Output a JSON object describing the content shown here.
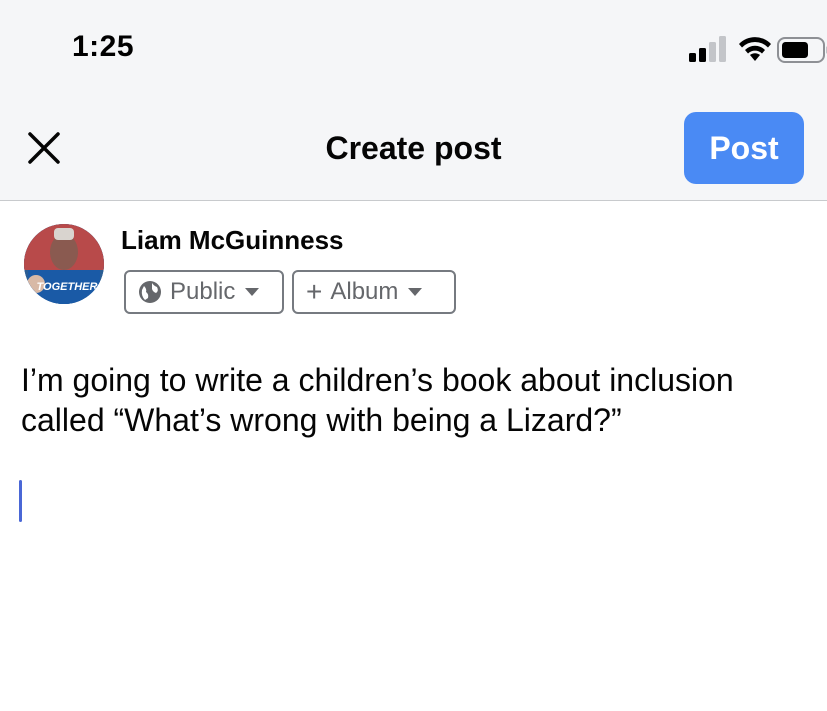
{
  "status_bar": {
    "time": "1:25",
    "icons": [
      "cellular-signal-icon",
      "wifi-icon",
      "battery-icon"
    ]
  },
  "header": {
    "close_icon": "close-icon",
    "title": "Create post",
    "post_label": "Post"
  },
  "author": {
    "name": "Liam McGuinness",
    "avatar_text": "TOGETHER"
  },
  "audience": {
    "label": "Public",
    "icon": "globe-icon"
  },
  "album": {
    "label": "Album",
    "icon": "plus-icon"
  },
  "composer": {
    "text": "I’m going to write a children’s book about inclusion called “What’s wrong with being a Lizard?”"
  },
  "colors": {
    "accent": "#4a8af4",
    "header_bg": "#f5f6f8",
    "cursor": "#4a67d6"
  }
}
